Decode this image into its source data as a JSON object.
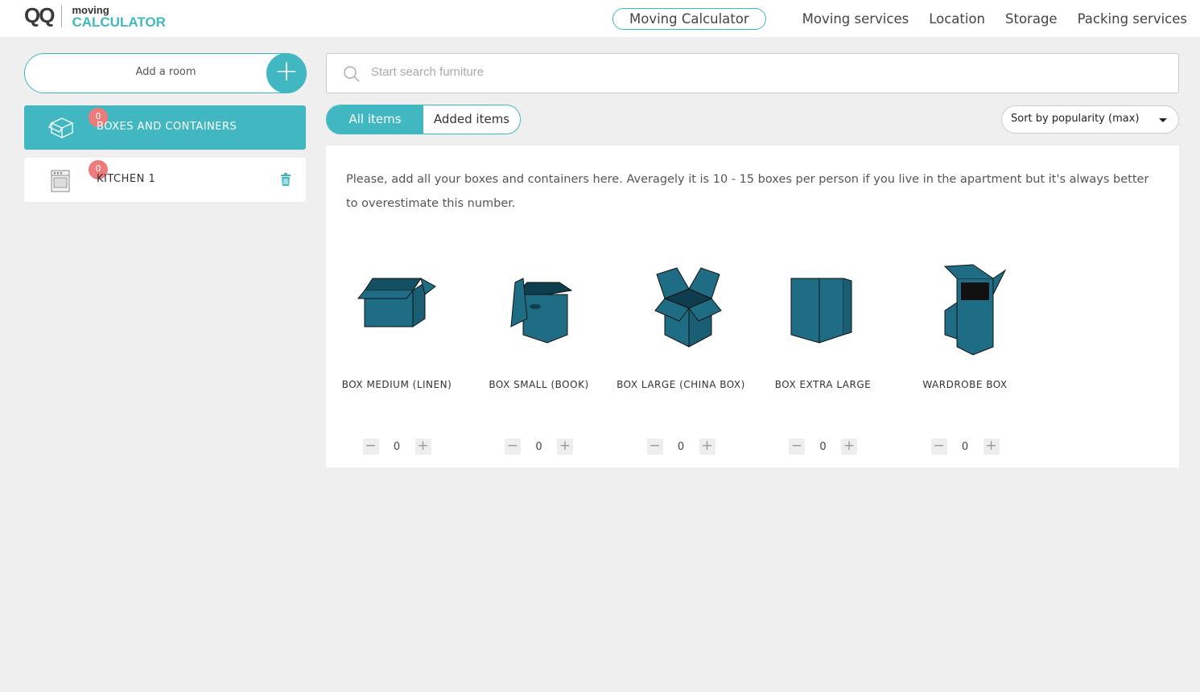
{
  "header": {
    "logo_mark": "QQ",
    "logo_top": "moving",
    "logo_bottom": "CALCULATOR",
    "nav": [
      "Moving Calculator",
      "Moving services",
      "Location",
      "Storage",
      "Packing services"
    ]
  },
  "colors": {
    "accent": "#41b8c1",
    "badge": "#ee7b7b",
    "box": "#1f6d85"
  },
  "sidebar": {
    "add_room": "Add a room",
    "rooms": [
      {
        "label": "BOXES AND CONTAINERS",
        "count": "0",
        "icon": "box-icon",
        "active": true
      },
      {
        "label": "KITCHEN 1",
        "count": "0",
        "icon": "stove-icon",
        "active": false
      }
    ]
  },
  "search": {
    "placeholder": "Start search furniture",
    "value": ""
  },
  "tabs": [
    "All items",
    "Added items"
  ],
  "sort": {
    "selected": "Sort by popularity (max)"
  },
  "description": "Please, add all your boxes and containers here. Averagely it is 10 - 15 boxes per person if you live in the apartment but it's always better to overestimate this number.",
  "products": [
    {
      "name": "BOX MEDIUM (LINEN)",
      "qty": "0"
    },
    {
      "name": "BOX SMALL (BOOK)",
      "qty": "0"
    },
    {
      "name": "BOX LARGE (CHINA BOX)",
      "qty": "0"
    },
    {
      "name": "BOX EXTRA LARGE",
      "qty": "0"
    },
    {
      "name": "WARDROBE BOX",
      "qty": "0"
    }
  ],
  "stepper": {
    "minus": "−",
    "plus": "+"
  }
}
